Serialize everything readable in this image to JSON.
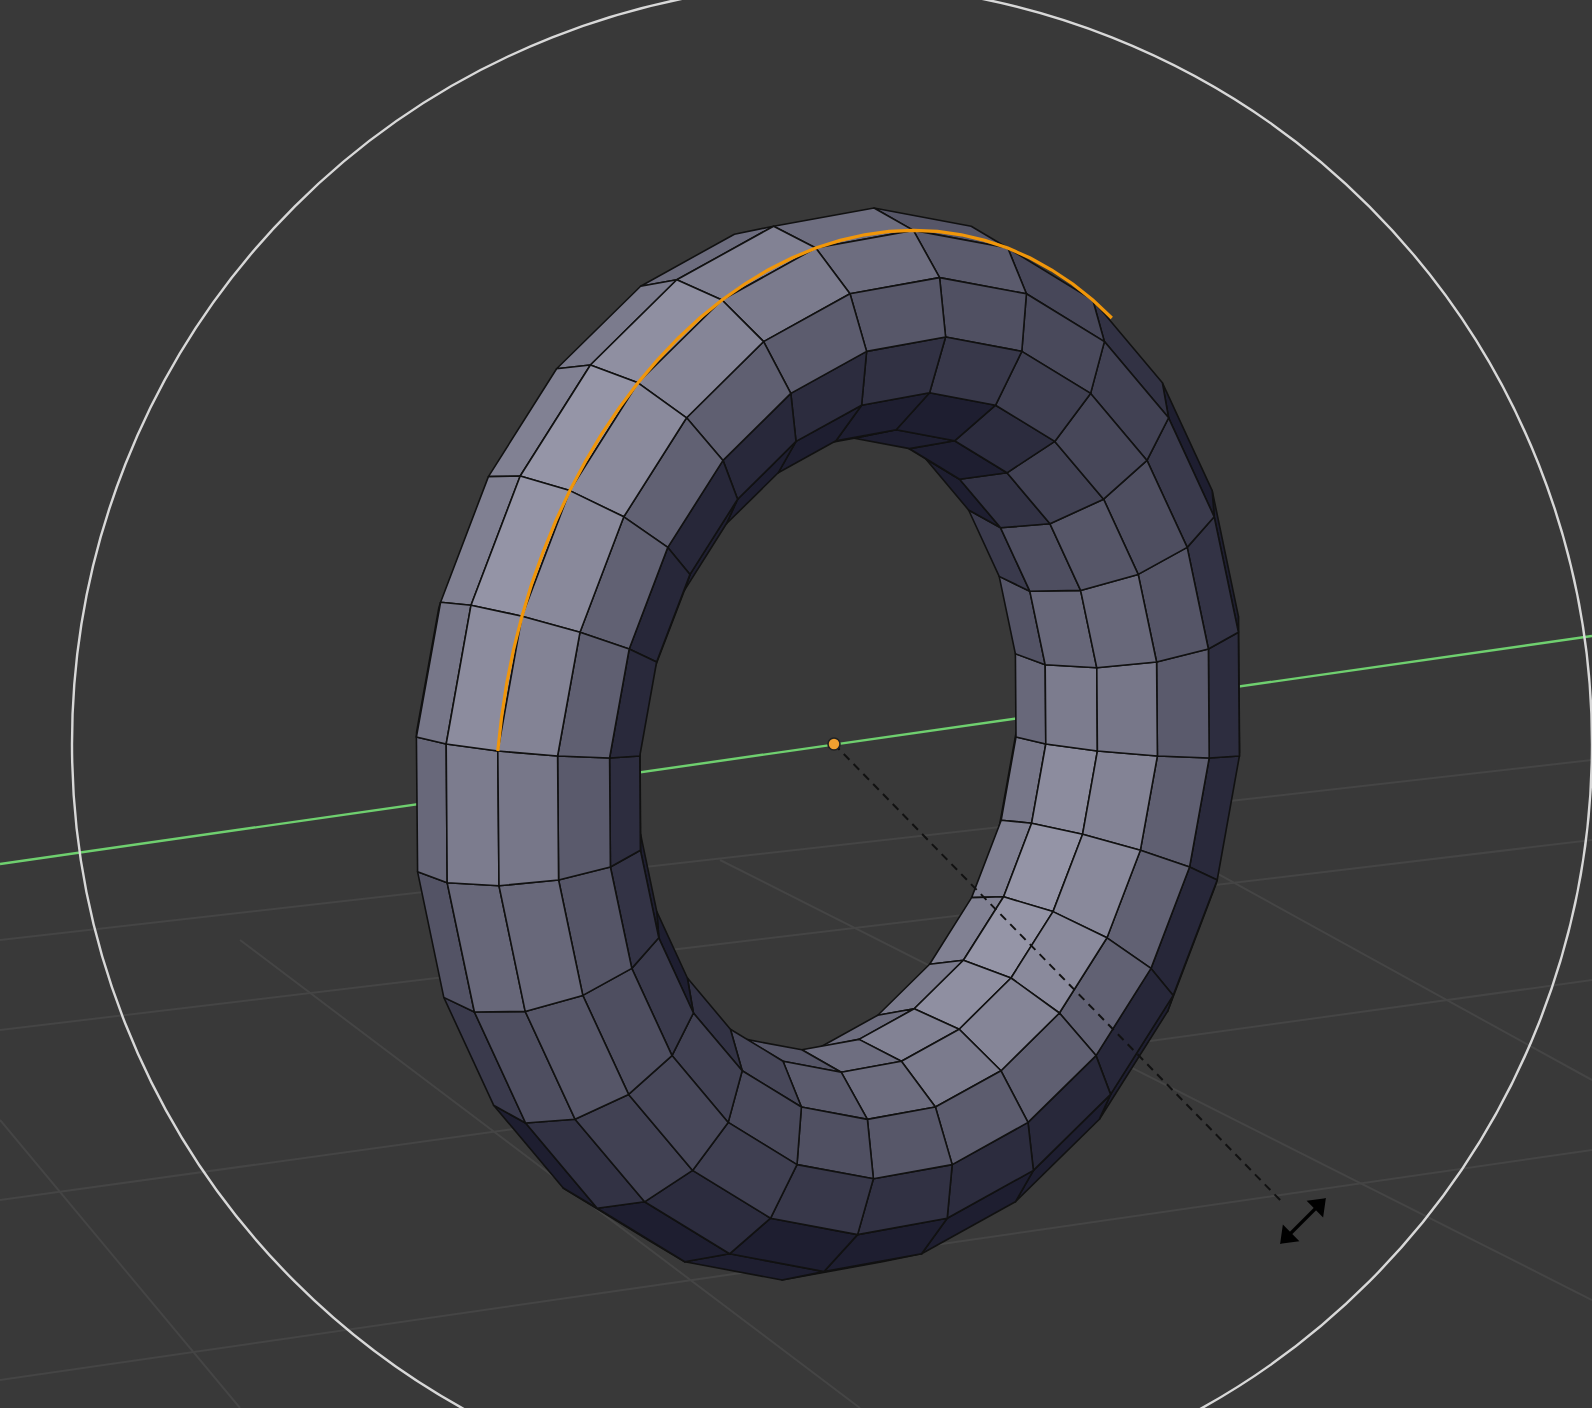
{
  "viewport": {
    "objects": [
      {
        "kind": "torus",
        "edge_loop_selected": true
      }
    ]
  }
}
